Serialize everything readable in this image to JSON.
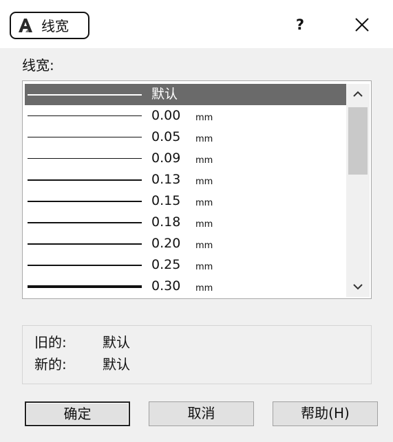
{
  "window": {
    "title": "线宽",
    "help": "?",
    "close_icon": "close-icon",
    "app_icon": "autocad-a-icon"
  },
  "listbox": {
    "label": "线宽:",
    "items": [
      {
        "value": "默认",
        "unit": "",
        "selected": true,
        "thickness": 2
      },
      {
        "value": "0.00",
        "unit": "mm",
        "selected": false,
        "thickness": 1
      },
      {
        "value": "0.05",
        "unit": "mm",
        "selected": false,
        "thickness": 1
      },
      {
        "value": "0.09",
        "unit": "mm",
        "selected": false,
        "thickness": 1
      },
      {
        "value": "0.13",
        "unit": "mm",
        "selected": false,
        "thickness": 2
      },
      {
        "value": "0.15",
        "unit": "mm",
        "selected": false,
        "thickness": 2
      },
      {
        "value": "0.18",
        "unit": "mm",
        "selected": false,
        "thickness": 2
      },
      {
        "value": "0.20",
        "unit": "mm",
        "selected": false,
        "thickness": 2
      },
      {
        "value": "0.25",
        "unit": "mm",
        "selected": false,
        "thickness": 2
      },
      {
        "value": "0.30",
        "unit": "mm",
        "selected": false,
        "thickness": 4
      }
    ]
  },
  "info": {
    "old_label": "旧的:",
    "old_value": "默认",
    "new_label": "新的:",
    "new_value": "默认"
  },
  "buttons": {
    "ok": "确定",
    "cancel": "取消",
    "help": "帮助(H)"
  },
  "colors": {
    "selection": "#6a6a6a",
    "dialog_bg": "#f0f0f0",
    "scroll_thumb": "#c9c9c9"
  }
}
